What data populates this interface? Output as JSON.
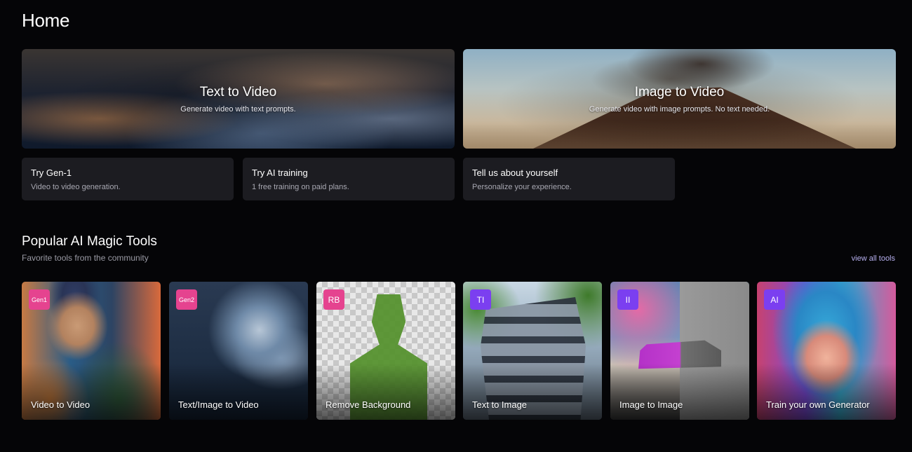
{
  "page": {
    "title": "Home"
  },
  "heroes": [
    {
      "title": "Text to Video",
      "subtitle": "Generate video with text prompts."
    },
    {
      "title": "Image to Video",
      "subtitle": "Generate video with image prompts. No text needed."
    }
  ],
  "actions": [
    {
      "title": "Try Gen-1",
      "subtitle": "Video to video generation."
    },
    {
      "title": "Try AI training",
      "subtitle": "1 free training on paid plans."
    },
    {
      "title": "Tell us about yourself",
      "subtitle": "Personalize your experience."
    }
  ],
  "section": {
    "title": "Popular AI Magic Tools",
    "subtitle": "Favorite tools from the community",
    "view_all": "view all tools"
  },
  "tools": [
    {
      "badge": "Gen1",
      "badge_color": "#e5438f",
      "label": "Video to Video"
    },
    {
      "badge": "Gen2",
      "badge_color": "#e5438f",
      "label": "Text/Image to Video"
    },
    {
      "badge": "RB",
      "badge_color": "#e5438f",
      "label": "Remove Background"
    },
    {
      "badge": "TI",
      "badge_color": "#7b3ff0",
      "label": "Text to Image"
    },
    {
      "badge": "II",
      "badge_color": "#7b3ff0",
      "label": "Image to Image"
    },
    {
      "badge": "AI",
      "badge_color": "#7b3ff0",
      "label": "Train your own Generator"
    }
  ],
  "colors": {
    "background": "#050507",
    "card": "#1c1c21",
    "link": "#b7b0ef",
    "badge_pink": "#e5438f",
    "badge_purple": "#7b3ff0"
  }
}
